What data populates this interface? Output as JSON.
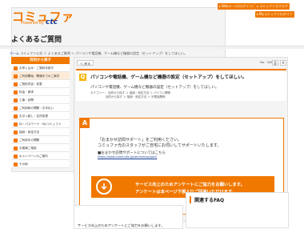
{
  "header": {
    "logo_main": "コミュファ",
    "logo_sub": "Powered by",
    "logo_brand": "ctc",
    "buttons": [
      {
        "label": "Webメール(ログイン)"
      },
      {
        "label": "コミュファスクエア"
      },
      {
        "label": "Myコミュファログイン"
      }
    ]
  },
  "page": {
    "title": "よくあるご質問",
    "breadcrumb_home": "ホーム",
    "breadcrumb_trail": "コミュファ公式 ＞ よくあるご質問 ＞ パソコンや電話機、ゲーム機など機器の設定（セットアップ）をしてほしい。"
  },
  "sidebar": {
    "heading": "目的から探す",
    "items": [
      {
        "label": "お申し込み・ご契約手続き"
      },
      {
        "label": "ご利用開始・開通までのご案内"
      },
      {
        "label": "ご契約内容・変更"
      },
      {
        "label": "料金・請求"
      },
      {
        "label": "工事・訪問"
      },
      {
        "label": "ご利用時の問題・お手伝い"
      },
      {
        "label": "お引っ越し・住所変更"
      },
      {
        "label": "ID・パスワード・Myコミュファ"
      },
      {
        "label": "接続・設定方法"
      },
      {
        "label": "ご利用中の問題"
      },
      {
        "label": "お客様ご相談"
      },
      {
        "label": "キャンペーンのご案内"
      },
      {
        "label": "その他"
      }
    ]
  },
  "question": {
    "back_label": "＜ 戻る",
    "number": "No：340",
    "print_icon": "print-icon",
    "title": "パソコンや電話機、ゲーム機など機器の設定（セットアップ）をしてほしい。",
    "body": "パソコンや電話機、ゲーム機など機器の設定（セットアップ）をしてほしい。",
    "category_label": "カテゴリー：",
    "categories": [
      "目的から探す ＞ 接続・設定方法 ＞ パソコン関係",
      "目的から探す ＞ 接続・設定方法 ＞ 光電話関係"
    ]
  },
  "answer": {
    "line1": "「おまかせ訪問サポート」をご利用ください。",
    "line2": "コミュファ光のスタッフがご自宅にお伺いしてサポートいたします。",
    "link_label": "■おまかせ訪問サポートについてはこちら",
    "link_url": "https://www.commufa.jp/service/support/",
    "banner_line1": "サービス向上のためアンケートにご協力をお願いします。",
    "banner_line2": "アンケートは本ページ下部よりご回答いただけます。"
  },
  "footer": {
    "survey_text": "サービス向上のためアンケートにご協力をお願いします。",
    "related_title": "関連するFAQ"
  },
  "colors": {
    "accent": "#f07800",
    "brand_blue": "#1a3f93"
  }
}
